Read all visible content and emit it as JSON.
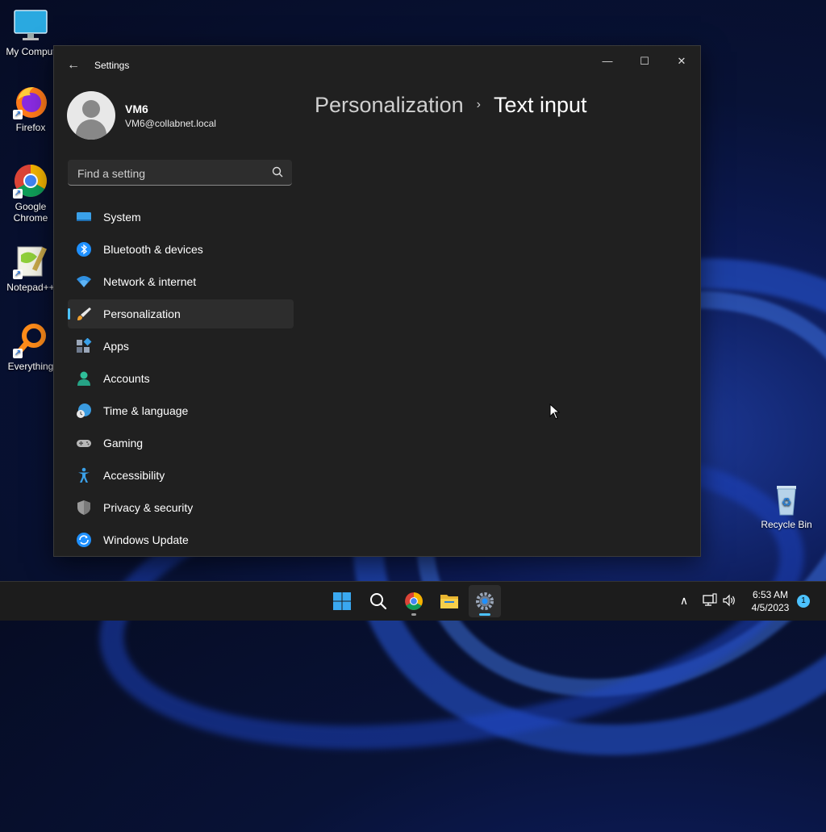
{
  "desktop": {
    "icons": [
      {
        "label": "My Comput",
        "icon": "monitor-icon"
      },
      {
        "label": "Firefox",
        "icon": "firefox-icon"
      },
      {
        "label": "Google Chrome",
        "icon": "chrome-icon"
      },
      {
        "label": "Notepad++",
        "icon": "notepadpp-icon"
      },
      {
        "label": "Everything",
        "icon": "magnifier-icon"
      },
      {
        "label": "Recycle Bin",
        "icon": "recycle-bin-icon"
      }
    ]
  },
  "window": {
    "title": "Settings",
    "controls": {
      "minimize": "—",
      "maximize": "☐",
      "close": "✕"
    },
    "back": "←"
  },
  "profile": {
    "name": "VM6",
    "email": "VM6@collabnet.local"
  },
  "search": {
    "placeholder": "Find a setting"
  },
  "nav": {
    "items": [
      {
        "label": "System",
        "icon": "system-icon"
      },
      {
        "label": "Bluetooth & devices",
        "icon": "bluetooth-icon"
      },
      {
        "label": "Network & internet",
        "icon": "wifi-icon"
      },
      {
        "label": "Personalization",
        "icon": "brush-icon",
        "selected": true
      },
      {
        "label": "Apps",
        "icon": "apps-icon"
      },
      {
        "label": "Accounts",
        "icon": "accounts-icon"
      },
      {
        "label": "Time & language",
        "icon": "time-language-icon"
      },
      {
        "label": "Gaming",
        "icon": "gamepad-icon"
      },
      {
        "label": "Accessibility",
        "icon": "accessibility-icon"
      },
      {
        "label": "Privacy & security",
        "icon": "shield-icon"
      },
      {
        "label": "Windows Update",
        "icon": "update-icon"
      }
    ]
  },
  "breadcrumb": {
    "parent": "Personalization",
    "separator": "›",
    "current": "Text input"
  },
  "taskbar": {
    "apps": [
      {
        "name": "start",
        "icon": "windows-logo-icon"
      },
      {
        "name": "search",
        "icon": "search-icon"
      },
      {
        "name": "chrome",
        "icon": "chrome-icon"
      },
      {
        "name": "file-explorer",
        "icon": "folder-icon"
      },
      {
        "name": "settings",
        "icon": "gear-icon",
        "active": true
      }
    ],
    "tray": {
      "chevron": "∧",
      "time": "6:53 AM",
      "date": "4/5/2023",
      "notifications": "1"
    }
  },
  "colors": {
    "accent": "#4cc2ff",
    "window_bg": "#202020",
    "taskbar_bg": "#1c1c1c"
  }
}
